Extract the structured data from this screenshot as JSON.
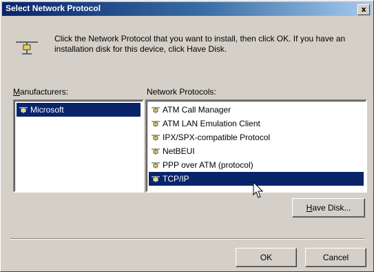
{
  "window": {
    "title": "Select Network Protocol",
    "close_label": "x"
  },
  "instructions": "Click the Network Protocol that you want to install, then click OK. If you have an installation disk for this device, click Have Disk.",
  "manufacturers": {
    "label_first": "M",
    "label_rest": "anufacturers:",
    "items": [
      {
        "label": "Microsoft",
        "selected": true
      }
    ]
  },
  "protocols": {
    "label": "Network Protocols:",
    "items": [
      {
        "label": "ATM Call Manager",
        "selected": false
      },
      {
        "label": "ATM LAN Emulation Client",
        "selected": false
      },
      {
        "label": "IPX/SPX-compatible Protocol",
        "selected": false
      },
      {
        "label": "NetBEUI",
        "selected": false
      },
      {
        "label": "PPP over ATM (protocol)",
        "selected": false
      },
      {
        "label": "TCP/IP",
        "selected": true
      }
    ]
  },
  "buttons": {
    "have_disk_first": "H",
    "have_disk_rest": "ave Disk...",
    "ok": "OK",
    "cancel": "Cancel"
  },
  "colors": {
    "dialog_bg": "#d4d0c8",
    "selection": "#0a246a",
    "title_gradient_start": "#0a246a",
    "title_gradient_end": "#a6caf0"
  },
  "icons": {
    "header": "network-protocol-icon",
    "item": "protocol-icon",
    "cursor": "mouse-pointer-icon"
  }
}
